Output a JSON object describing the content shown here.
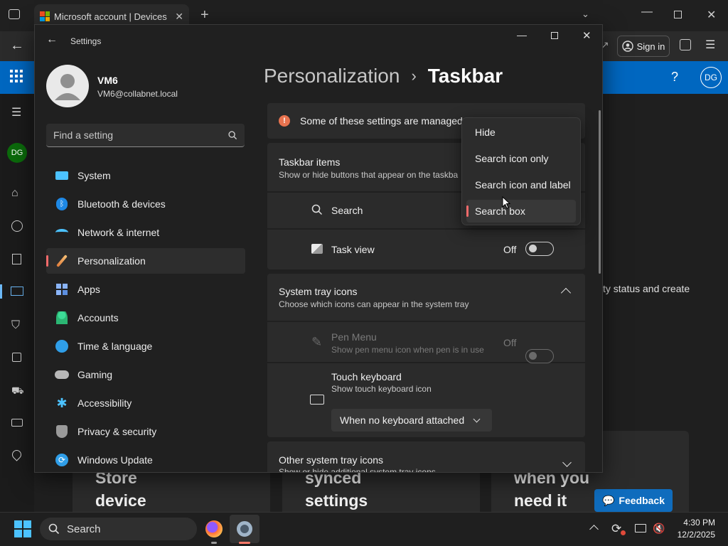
{
  "browser": {
    "tab_title": "Microsoft account | Devices",
    "signin_label": "Sign in",
    "avatar_initials": "DG"
  },
  "page": {
    "side_avatar": "DG",
    "text_partial": "ty status and create",
    "card1": [
      "Store",
      "device"
    ],
    "card2": [
      "synced",
      "settings"
    ],
    "card3": [
      "when you",
      "need it"
    ],
    "feedback_label": "Feedback"
  },
  "settings": {
    "window_title": "Settings",
    "user": {
      "name": "VM6",
      "email": "VM6@collabnet.local"
    },
    "search_placeholder": "Find a setting",
    "nav": [
      {
        "label": "System",
        "icon": "system-icon"
      },
      {
        "label": "Bluetooth & devices",
        "icon": "bluetooth-icon"
      },
      {
        "label": "Network & internet",
        "icon": "wifi-icon"
      },
      {
        "label": "Personalization",
        "icon": "brush-icon"
      },
      {
        "label": "Apps",
        "icon": "apps-icon"
      },
      {
        "label": "Accounts",
        "icon": "accounts-icon"
      },
      {
        "label": "Time & language",
        "icon": "globe-clock-icon"
      },
      {
        "label": "Gaming",
        "icon": "gamepad-icon"
      },
      {
        "label": "Accessibility",
        "icon": "accessibility-icon"
      },
      {
        "label": "Privacy & security",
        "icon": "shield-icon"
      },
      {
        "label": "Windows Update",
        "icon": "update-icon"
      }
    ],
    "breadcrumb_parent": "Personalization",
    "breadcrumb_sep": "›",
    "breadcrumb_current": "Taskbar",
    "managed_notice": "Some of these settings are managed",
    "taskbar_items": {
      "title": "Taskbar items",
      "subtitle": "Show or hide buttons that appear on the taskba",
      "search_label": "Search",
      "taskview_label": "Task view",
      "taskview_state": "Off"
    },
    "search_menu": {
      "options": [
        "Hide",
        "Search icon only",
        "Search icon and label",
        "Search box"
      ],
      "selected": "Search box"
    },
    "system_tray": {
      "title": "System tray icons",
      "subtitle": "Choose which icons can appear in the system tray",
      "pen_title": "Pen Menu",
      "pen_subtitle": "Show pen menu icon when pen is in use",
      "pen_state": "Off",
      "touch_title": "Touch keyboard",
      "touch_subtitle": "Show touch keyboard icon",
      "touch_value": "When no keyboard attached"
    },
    "other_tray": {
      "title": "Other system tray icons",
      "subtitle": "Show or hide additional system tray icons"
    }
  },
  "taskbar": {
    "search_label": "Search",
    "time": "4:30 PM",
    "date": "12/2/2025"
  },
  "colors": {
    "accent": "#0067c0",
    "selection_mark": "#f16a6a",
    "feedback": "#0f6cbd"
  }
}
